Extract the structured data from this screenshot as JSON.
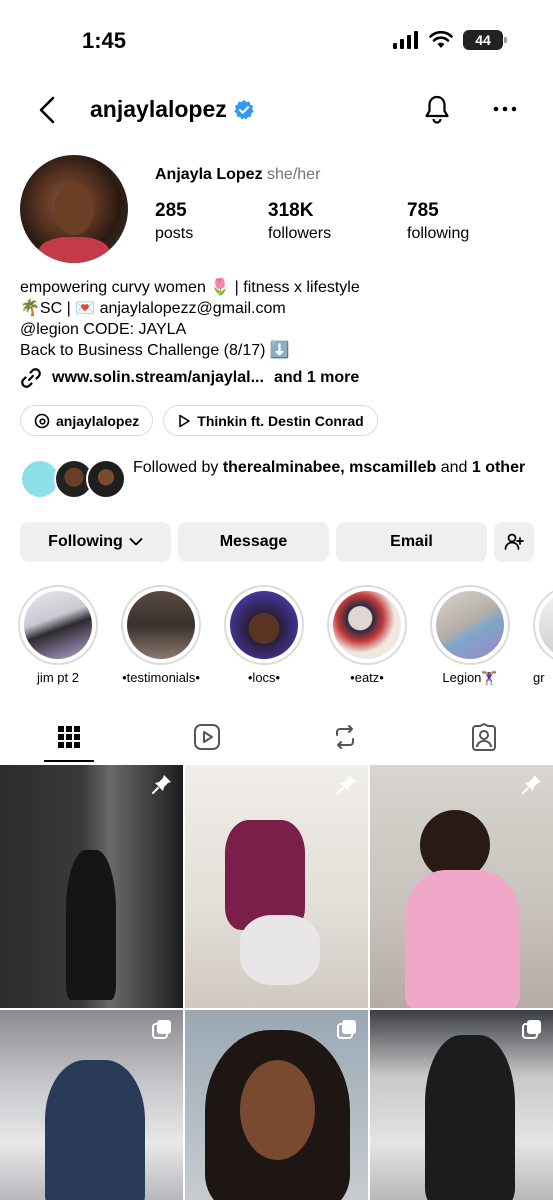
{
  "status_bar": {
    "time": "1:45",
    "battery": "44"
  },
  "header": {
    "username": "anjaylalopez"
  },
  "profile": {
    "display_name": "Anjayla Lopez",
    "pronouns": "she/her",
    "stats": [
      {
        "value": "285",
        "label": "posts"
      },
      {
        "value": "318K",
        "label": "followers"
      },
      {
        "value": "785",
        "label": "following"
      }
    ],
    "bio": [
      "empowering curvy women 🌷 | fitness x lifestyle",
      "🌴SC | 💌 anjaylalopezz@gmail.com",
      "@legion CODE: JAYLA",
      "Back to Business Challenge (8/17) ⬇️"
    ],
    "link_text": "www.solin.stream/anjaylal...",
    "link_more": "and 1 more",
    "chips": [
      {
        "label": "anjaylalopez",
        "icon": "threads-icon"
      },
      {
        "label": "Thinkin ft. Destin Conrad",
        "icon": "play-icon"
      }
    ]
  },
  "followed_by": {
    "prefix": "Followed by ",
    "names": "therealminabee, mscamilleb",
    "suffix_and": " and ",
    "others": "1 other"
  },
  "actions": {
    "following": "Following",
    "message": "Message",
    "email": "Email"
  },
  "highlights": [
    {
      "label": "jim pt 2"
    },
    {
      "label": "•testimonials•"
    },
    {
      "label": "•locs•"
    },
    {
      "label": "•eatz•"
    },
    {
      "label": "Legion🏋🏾‍♀️"
    },
    {
      "label": "gr"
    }
  ],
  "tabs": [
    "grid-icon",
    "reels-icon",
    "reposts-icon",
    "tagged-icon"
  ],
  "colors": {
    "verified": "#3897f0",
    "button_bg": "#efefef",
    "border": "#dbdbdb"
  }
}
